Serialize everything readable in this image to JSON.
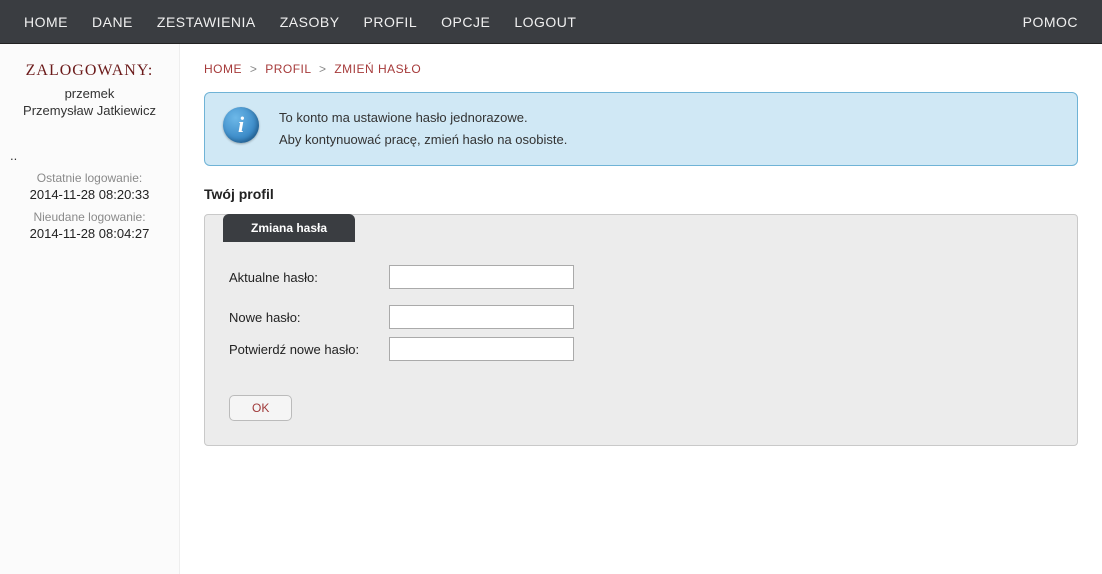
{
  "nav": {
    "home": "HOME",
    "dane": "DANE",
    "zestawienia": "ZESTAWIENIA",
    "zasoby": "ZASOBY",
    "profil": "PROFIL",
    "opcje": "OPCJE",
    "logout": "LOGOUT",
    "pomoc": "POMOC"
  },
  "sidebar": {
    "title": "ZALOGOWANY:",
    "username": "przemek",
    "fullname": "Przemysław Jatkiewicz",
    "dots": "..",
    "last_login_label": "Ostatnie logowanie:",
    "last_login_value": "2014-11-28 08:20:33",
    "failed_login_label": "Nieudane logowanie:",
    "failed_login_value": "2014-11-28 08:04:27"
  },
  "breadcrumb": {
    "home": "HOME",
    "profil": "PROFIL",
    "current": "ZMIEŃ HASŁO",
    "sep": ">"
  },
  "info": {
    "line1": "To konto ma ustawione hasło jednorazowe.",
    "line2": "Aby kontynuować pracę, zmień hasło na osobiste."
  },
  "profile": {
    "heading": "Twój profil",
    "panel_title": "Zmiana hasła",
    "current_pw_label": "Aktualne hasło:",
    "new_pw_label": "Nowe hasło:",
    "confirm_pw_label": "Potwierdź nowe hasło:",
    "ok_button": "OK"
  }
}
